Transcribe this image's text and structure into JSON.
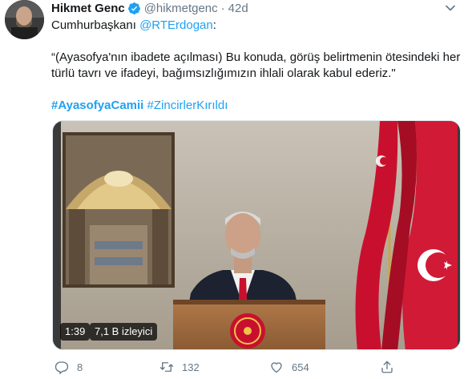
{
  "tweet": {
    "author_name": "Hikmet Genc",
    "author_handle": "@hikmetgenc",
    "separator": "·",
    "time": "42d",
    "line1_prefix": "Cumhurbaşkanı ",
    "line1_mention": "@RTErdogan",
    "line1_suffix": ":",
    "quote_line1": "“(Ayasofya'nın ibadete açılması) Bu konuda, görüş belirtmenin ötesindeki her",
    "quote_line2": "türlü tavrı ve ifadeyi, bağımsızlığımızın ihlali olarak kabul ederiz.\"",
    "hashtag1": "#AyasofyaCamii",
    "hashtag2": "#ZincirlerKırıldı"
  },
  "video": {
    "duration": "1:39",
    "views": "7,1 B izleyici"
  },
  "actions": {
    "reply_count": "8",
    "retweet_count": "132",
    "like_count": "654"
  },
  "colors": {
    "link": "#1da1f2",
    "secondary_text": "#657786",
    "verified_badge": "#1da1f2",
    "flag_red": "#c8102e"
  },
  "icons": [
    "verified-badge-icon",
    "chevron-down-icon",
    "reply-icon",
    "retweet-icon",
    "like-icon",
    "share-icon"
  ]
}
